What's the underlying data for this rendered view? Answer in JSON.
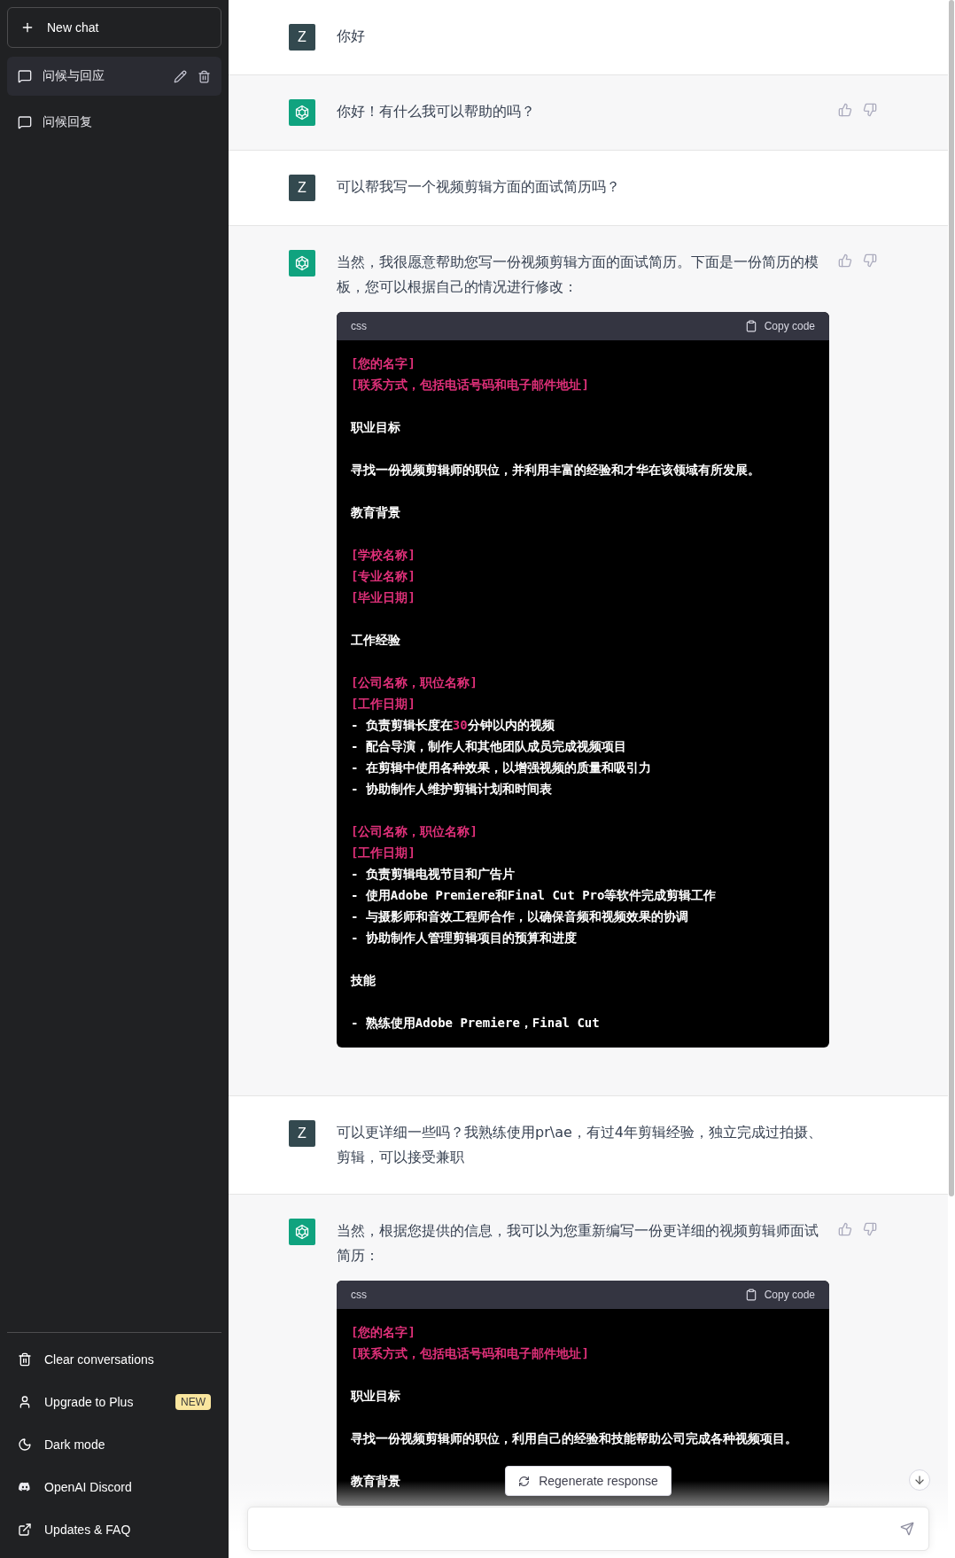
{
  "sidebar": {
    "new_chat_label": "New chat",
    "conversations": [
      {
        "title": "问候与回应",
        "selected": true
      },
      {
        "title": "问候回复",
        "selected": false
      }
    ],
    "footer_items": [
      {
        "label": "Clear conversations",
        "kind": "trash"
      },
      {
        "label": "Upgrade to Plus",
        "kind": "user",
        "badge": "NEW"
      },
      {
        "label": "Dark mode",
        "kind": "moon"
      },
      {
        "label": "OpenAI Discord",
        "kind": "discord"
      },
      {
        "label": "Updates & FAQ",
        "kind": "external"
      }
    ]
  },
  "messages": [
    {
      "kind": "user",
      "avatar": "Z",
      "text": "你好"
    },
    {
      "kind": "assistant",
      "text": "你好！有什么我可以帮助的吗？"
    },
    {
      "kind": "user",
      "avatar": "Z",
      "text": "可以帮我写一个视频剪辑方面的面试简历吗？"
    },
    {
      "kind": "assistant",
      "text": "当然，我很愿意帮助您写一份视频剪辑方面的面试简历。下面是一份简历的模板，您可以根据自己的情况进行修改：",
      "code": {
        "language": "css",
        "copy_label": "Copy code",
        "groups": [
          [
            [
              {
                "text": "[您的名字]",
                "kind": "string"
              }
            ],
            [
              {
                "text": "[联系方式，包括电话号码和电子邮件地址]",
                "kind": "string"
              }
            ]
          ],
          [
            [
              {
                "text": "职业目标",
                "kind": "plain"
              }
            ]
          ],
          [
            [
              {
                "text": "寻找一份视频剪辑师的职位，并利用丰富的经验和才华在该领域有所发展。",
                "kind": "plain"
              }
            ]
          ],
          [
            [
              {
                "text": "教育背景",
                "kind": "plain"
              }
            ]
          ],
          [
            [
              {
                "text": "[学校名称]",
                "kind": "string"
              }
            ],
            [
              {
                "text": "[专业名称]",
                "kind": "string"
              }
            ],
            [
              {
                "text": "[毕业日期]",
                "kind": "string"
              }
            ]
          ],
          [
            [
              {
                "text": "工作经验",
                "kind": "plain"
              }
            ]
          ],
          [
            [
              {
                "text": "[公司名称，职位名称]",
                "kind": "string"
              }
            ],
            [
              {
                "text": "[工作日期]",
                "kind": "string"
              }
            ],
            [
              {
                "text": "- 负责剪辑长度在",
                "kind": "plain"
              },
              {
                "text": "30",
                "kind": "number"
              },
              {
                "text": "分钟以内的视频",
                "kind": "plain"
              }
            ],
            [
              {
                "text": "- 配合导演，制作人和其他团队成员完成视频项目",
                "kind": "plain"
              }
            ],
            [
              {
                "text": "- 在剪辑中使用各种效果，以增强视频的质量和吸引力",
                "kind": "plain"
              }
            ],
            [
              {
                "text": "- 协助制作人维护剪辑计划和时间表",
                "kind": "plain"
              }
            ]
          ],
          [
            [
              {
                "text": "[公司名称，职位名称]",
                "kind": "string"
              }
            ],
            [
              {
                "text": "[工作日期]",
                "kind": "string"
              }
            ],
            [
              {
                "text": "- 负责剪辑电视节目和广告片",
                "kind": "plain"
              }
            ],
            [
              {
                "text": "- 使用Adobe Premiere和Final Cut Pro等软件完成剪辑工作",
                "kind": "plain"
              }
            ],
            [
              {
                "text": "- 与摄影师和音效工程师合作，以确保音频和视频效果的协调",
                "kind": "plain"
              }
            ],
            [
              {
                "text": "- 协助制作人管理剪辑项目的预算和进度",
                "kind": "plain"
              }
            ]
          ],
          [
            [
              {
                "text": "技能",
                "kind": "plain"
              }
            ]
          ],
          [
            [
              {
                "text": "- 熟练使用Adobe Premiere，Final Cut",
                "kind": "plain"
              }
            ]
          ]
        ]
      }
    },
    {
      "kind": "user",
      "avatar": "Z",
      "text": "可以更详细一些吗？我熟练使用pr\\ae，有过4年剪辑经验，独立完成过拍摄、剪辑，可以接受兼职"
    },
    {
      "kind": "assistant",
      "text": "当然，根据您提供的信息，我可以为您重新编写一份更详细的视频剪辑师面试简历：",
      "code": {
        "language": "css",
        "copy_label": "Copy code",
        "groups": [
          [
            [
              {
                "text": "[您的名字]",
                "kind": "string"
              }
            ],
            [
              {
                "text": "[联系方式，包括电话号码和电子邮件地址]",
                "kind": "string"
              }
            ]
          ],
          [
            [
              {
                "text": "职业目标",
                "kind": "plain"
              }
            ]
          ],
          [
            [
              {
                "text": "寻找一份视频剪辑师的职位，利用自己的经验和技能帮助公司完成各种视频项目。",
                "kind": "plain"
              }
            ]
          ],
          [
            [
              {
                "text": "教育背景",
                "kind": "plain"
              }
            ]
          ]
        ]
      }
    }
  ],
  "regenerate_label": "Regenerate response"
}
